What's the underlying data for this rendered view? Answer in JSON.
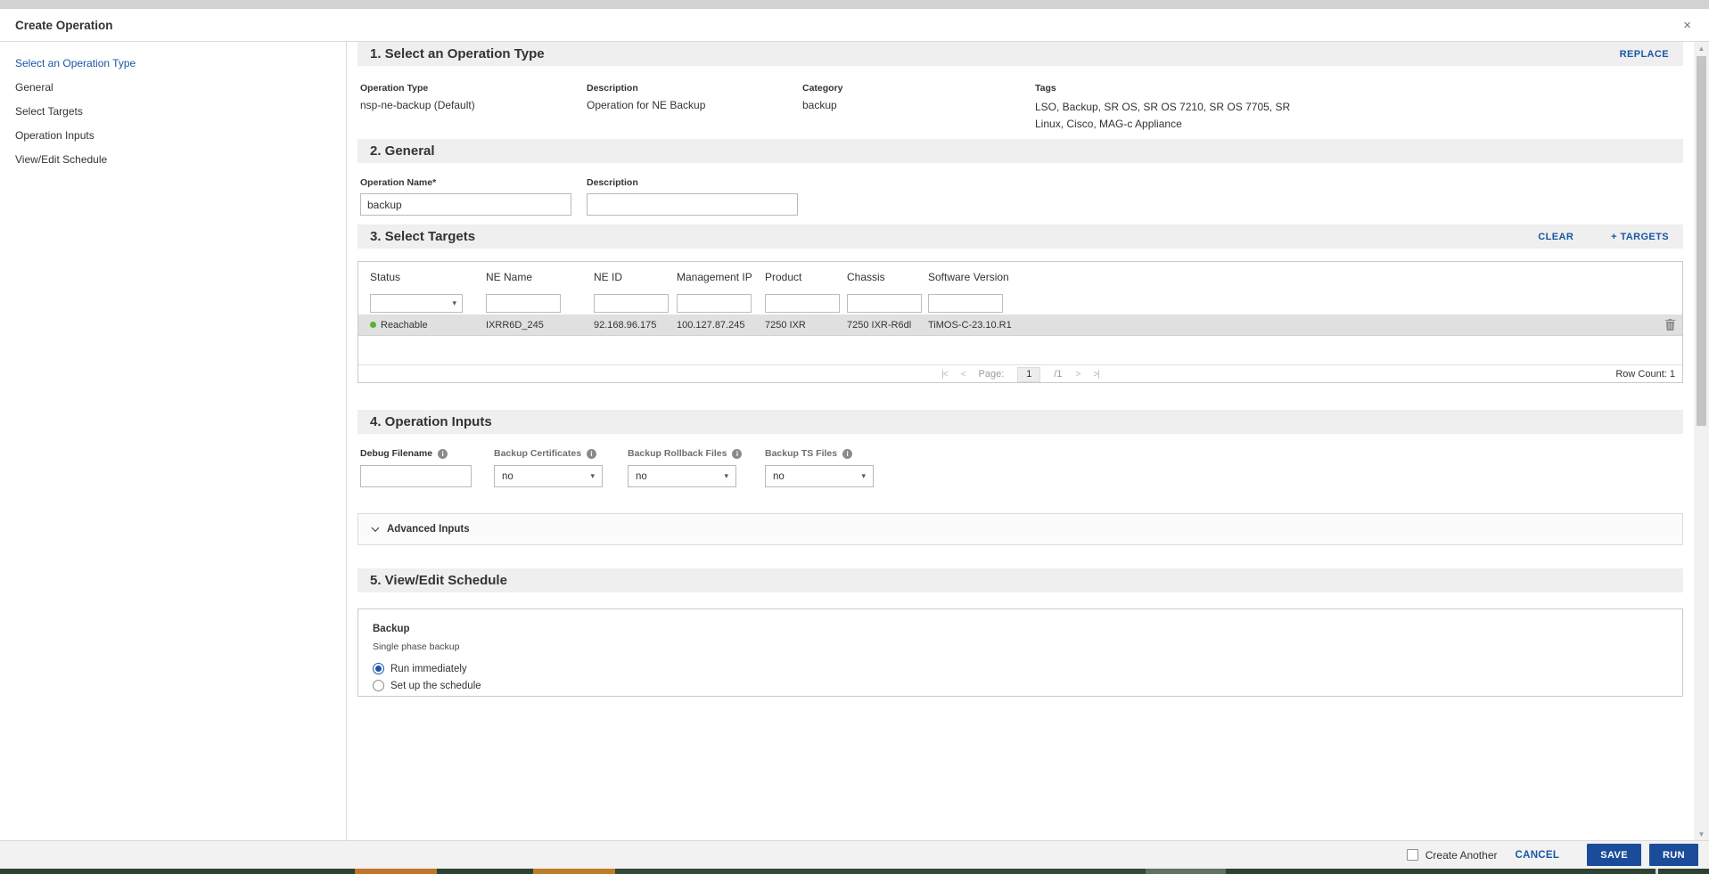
{
  "colors": {
    "accent_link": "#1a57a5",
    "button_blue": "#1b4c99",
    "status_green": "#5bb12f",
    "section_header_bg": "#efefef",
    "selected_row": "#e0e0e0"
  },
  "dialog": {
    "title": "Create Operation",
    "close_icon": "×"
  },
  "sidebar": {
    "items": [
      {
        "label": "Select an Operation Type",
        "active": true
      },
      {
        "label": "General",
        "active": false
      },
      {
        "label": "Select Targets",
        "active": false
      },
      {
        "label": "Operation Inputs",
        "active": false
      },
      {
        "label": "View/Edit Schedule",
        "active": false
      }
    ]
  },
  "operation_type": {
    "heading": "1. Select an Operation Type",
    "replace_label": "REPLACE",
    "fields": [
      {
        "label": "Operation Type",
        "value": "nsp-ne-backup (Default)"
      },
      {
        "label": "Description",
        "value": "Operation for NE Backup"
      },
      {
        "label": "Category",
        "value": "backup"
      },
      {
        "label": "Tags",
        "value": "LSO, Backup, SR OS, SR OS 7210, SR OS 7705, SR Linux, Cisco, MAG-c Appliance"
      }
    ]
  },
  "general": {
    "heading": "2. General",
    "name_label": "Operation Name*",
    "name_value": "backup",
    "description_label": "Description",
    "description_value": ""
  },
  "targets": {
    "heading": "3. Select Targets",
    "clear_label": "CLEAR",
    "add_label": "+ TARGETS",
    "columns": [
      "Status",
      "NE Name",
      "NE ID",
      "Management IP",
      "Product",
      "Chassis",
      "Software Version"
    ],
    "rows": [
      {
        "status": "Reachable",
        "ne_name": "IXRR6D_245",
        "ne_id": "92.168.96.175",
        "management_ip": "100.127.87.245",
        "product": "7250 IXR",
        "chassis": "7250 IXR-R6dl",
        "software_version": "TiMOS-C-23.10.R1"
      }
    ],
    "pagination": {
      "first": "|<",
      "prev": "<",
      "page_label": "Page:",
      "page": "1",
      "total": "/1",
      "next": ">",
      "last": ">|"
    },
    "row_count": "Row Count: 1"
  },
  "inputs": {
    "heading": "4. Operation Inputs",
    "debug_label": "Debug Filename",
    "debug_value": "",
    "selects": [
      {
        "label": "Backup Certificates",
        "value": "no"
      },
      {
        "label": "Backup Rollback Files",
        "value": "no"
      },
      {
        "label": "Backup TS Files",
        "value": "no"
      }
    ],
    "advanced_label": "Advanced Inputs"
  },
  "schedule": {
    "heading": "5. View/Edit Schedule",
    "box_title": "Backup",
    "box_subtitle": "Single phase backup",
    "options": [
      {
        "label": "Run immediately",
        "selected": true
      },
      {
        "label": "Set up the schedule",
        "selected": false
      }
    ]
  },
  "footer": {
    "create_another_label": "Create Another",
    "cancel_label": "CANCEL",
    "save_label": "SAVE",
    "run_label": "RUN"
  }
}
